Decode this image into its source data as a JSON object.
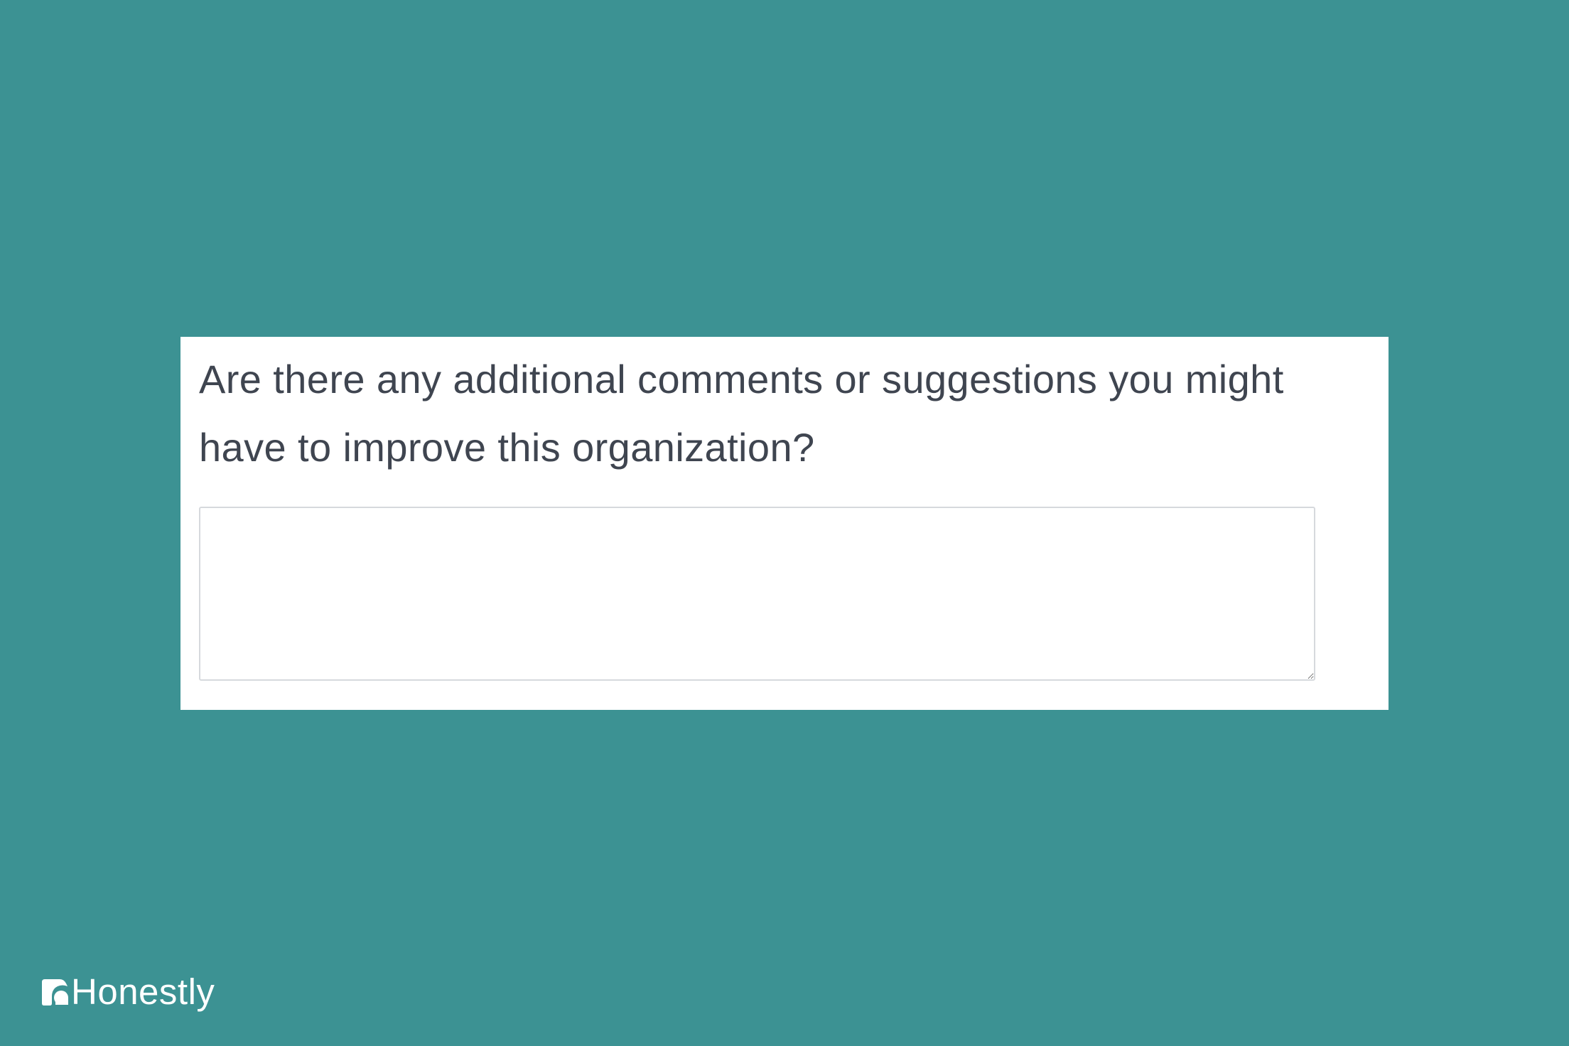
{
  "page": {
    "background_color": "#3c9293",
    "card_color": "#ffffff",
    "text_color": "#3f4550",
    "border_color": "#d6d9dd"
  },
  "survey": {
    "question": "Are there any additional comments or suggestions you might have to improve this organization?",
    "answer_value": "",
    "answer_placeholder": ""
  },
  "brand": {
    "name": "Honestly",
    "icon": "honestly-logo-icon",
    "color": "#ffffff"
  }
}
